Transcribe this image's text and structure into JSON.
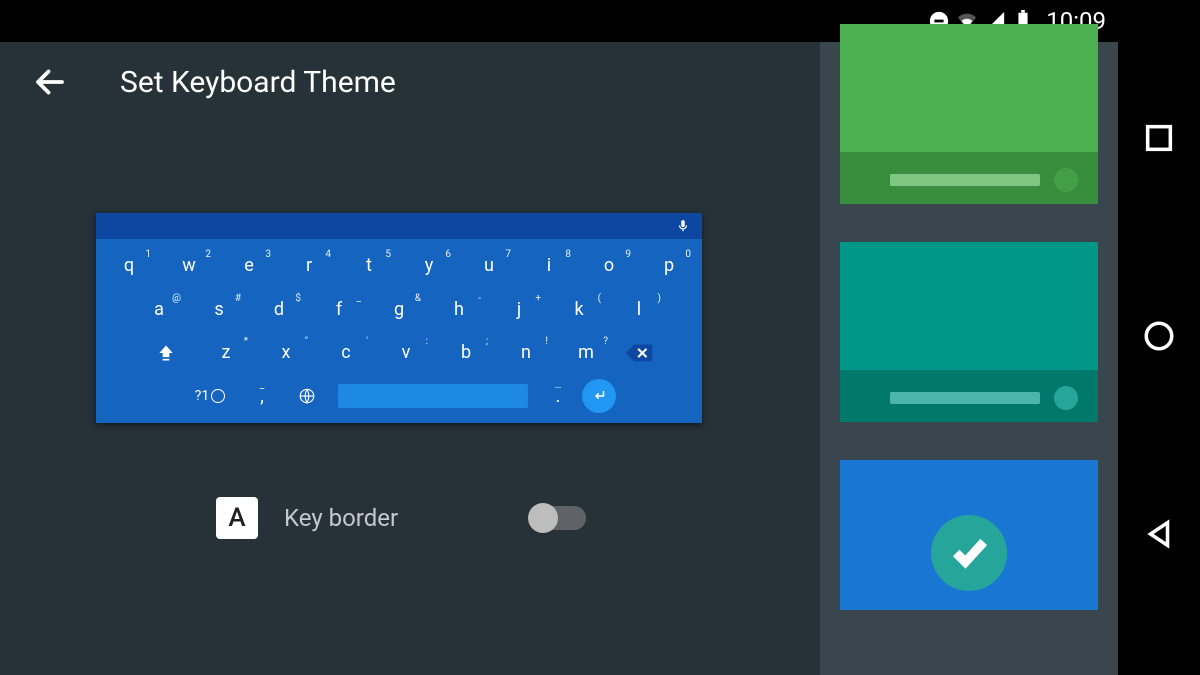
{
  "status": {
    "time": "10:09"
  },
  "header": {
    "title": "Set Keyboard Theme"
  },
  "keyboard": {
    "row1": [
      {
        "k": "q",
        "s": "1"
      },
      {
        "k": "w",
        "s": "2"
      },
      {
        "k": "e",
        "s": "3"
      },
      {
        "k": "r",
        "s": "4"
      },
      {
        "k": "t",
        "s": "5"
      },
      {
        "k": "y",
        "s": "6"
      },
      {
        "k": "u",
        "s": "7"
      },
      {
        "k": "i",
        "s": "8"
      },
      {
        "k": "o",
        "s": "9"
      },
      {
        "k": "p",
        "s": "0"
      }
    ],
    "row2": [
      {
        "k": "a",
        "s": "@"
      },
      {
        "k": "s",
        "s": "#"
      },
      {
        "k": "d",
        "s": "$"
      },
      {
        "k": "f",
        "s": "_"
      },
      {
        "k": "g",
        "s": "&"
      },
      {
        "k": "h",
        "s": "-"
      },
      {
        "k": "j",
        "s": "+"
      },
      {
        "k": "k",
        "s": "("
      },
      {
        "k": "l",
        "s": ")"
      }
    ],
    "row3": [
      {
        "k": "z",
        "s": "*"
      },
      {
        "k": "x",
        "s": "\""
      },
      {
        "k": "c",
        "s": "'"
      },
      {
        "k": "v",
        "s": ":"
      },
      {
        "k": "b",
        "s": ";"
      },
      {
        "k": "n",
        "s": "!"
      },
      {
        "k": "m",
        "s": "?"
      }
    ],
    "symbol_key": "?1"
  },
  "setting": {
    "icon_letter": "A",
    "label": "Key border",
    "on": false
  },
  "themes": {
    "items": [
      {
        "id": "green",
        "selected": false
      },
      {
        "id": "teal",
        "selected": false
      },
      {
        "id": "blue",
        "selected": true
      }
    ]
  }
}
